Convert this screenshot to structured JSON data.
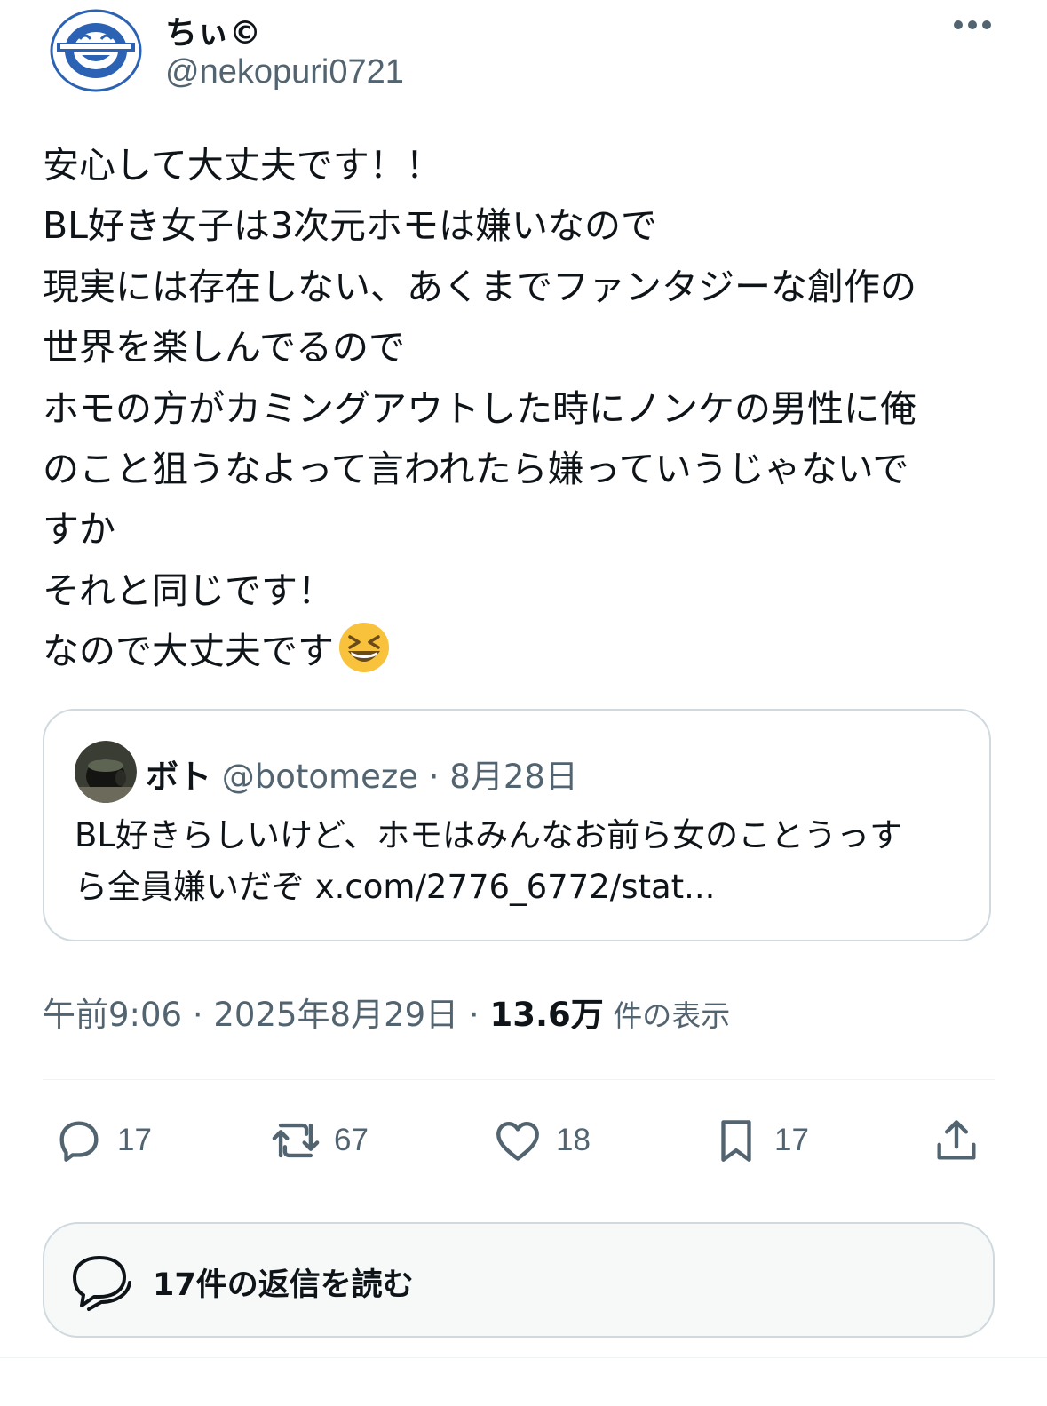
{
  "header": {
    "display_name": "ちぃ©",
    "handle": "@nekopuri0721",
    "avatar_icon": "laughing-man-logo",
    "more_icon": "more-horizontal-icon"
  },
  "post": {
    "lines": [
      "安心して大丈夫です！！",
      "BL好き女子は3次元ホモは嫌いなので",
      "現実には存在しない、あくまでファンタジーな創作の",
      "世界を楽しんでるので",
      "ホモの方がカミングアウトした時にノンケの男性に俺",
      "のこと狙うなよって言われたら嫌っていうじゃないで",
      "すか",
      "それと同じです！",
      "なので大丈夫です"
    ],
    "emoji": "grinning-squinting-face"
  },
  "quote": {
    "name": "ボト",
    "handle_date": " @botomeze · 8月28日",
    "lines": [
      "BL好きらしいけど、ホモはみんなお前ら女のことうっす",
      "ら全員嫌いだぞ x.com/2776_6772/stat..."
    ]
  },
  "meta": {
    "time_date": "午前9:06 · 2025年8月29日 · ",
    "views": "13.6万",
    "views_label": " 件の表示"
  },
  "actions": {
    "replies": "17",
    "reposts": "67",
    "likes": "18",
    "bookmarks": "17",
    "icons": [
      "reply-icon",
      "repost-icon",
      "like-icon",
      "bookmark-icon",
      "share-icon"
    ]
  },
  "read_replies": {
    "label": "17件の返信を読む"
  },
  "colors": {
    "text": "#0f1419",
    "secondary": "#536471",
    "border": "#cfd9de",
    "logo_blue": "#2b62b4"
  }
}
